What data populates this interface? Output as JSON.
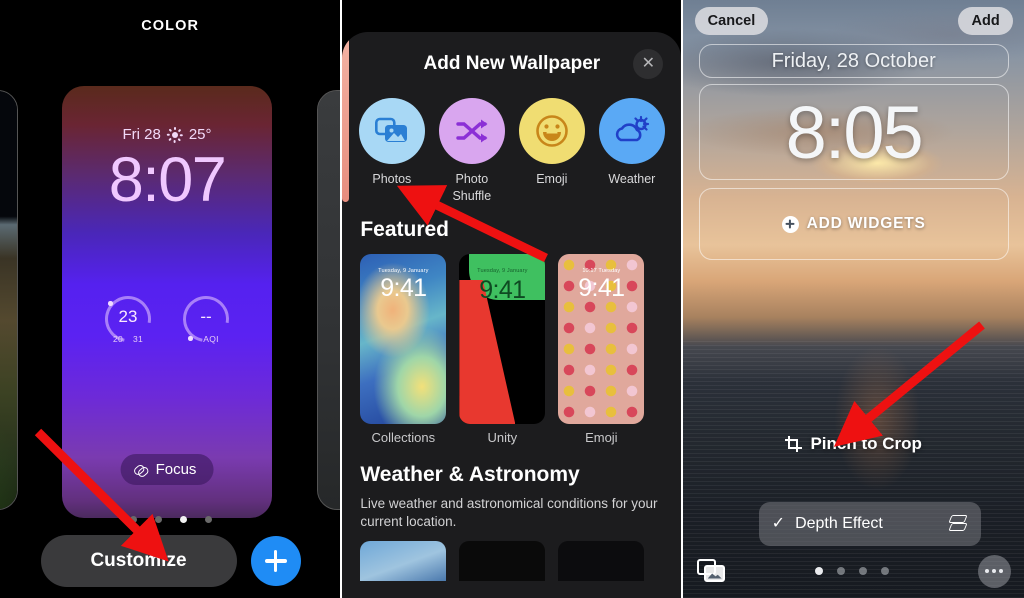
{
  "panel1": {
    "header": "COLOR",
    "preview": {
      "date": "Fri 28",
      "weather_icon": "sun-icon",
      "temperature": "25°",
      "time": "8:07",
      "gauge1": {
        "value": "23",
        "low": "20",
        "high": "31"
      },
      "gauge2": {
        "value": "--",
        "label": "AQI"
      },
      "focus_label": "Focus",
      "focus_icon": "link-icon"
    },
    "page_dots": {
      "count": 4,
      "active": 2
    },
    "customize_label": "Customize",
    "add_icon": "plus-icon"
  },
  "panel2": {
    "sheet_title": "Add New Wallpaper",
    "close_icon": "close-icon",
    "types": [
      {
        "label": "Photos",
        "icon": "photos-icon",
        "circle_color": "#a8d8f5",
        "glyph_color": "#2a7fd4"
      },
      {
        "label": "Photo Shuffle",
        "icon": "shuffle-icon",
        "circle_color": "#d9a6ef",
        "glyph_color": "#8b2fd6"
      },
      {
        "label": "Emoji",
        "icon": "smiley-icon",
        "circle_color": "#f0dd72",
        "glyph_color": "#c8861a"
      },
      {
        "label": "Weather",
        "icon": "weather-icon",
        "circle_color": "#5aa9f5",
        "glyph_color": "#2040c8"
      }
    ],
    "featured": {
      "title": "Featured",
      "items": [
        {
          "caption": "Collections",
          "date": "Tuesday, 9 January",
          "time": "9:41"
        },
        {
          "caption": "Unity",
          "date": "Tuesday, 9 January",
          "time": "9:41"
        },
        {
          "caption": "Emoji",
          "date": "10:17  Tuesday",
          "time": "9:41"
        }
      ]
    },
    "weather_section": {
      "title": "Weather & Astronomy",
      "subtitle": "Live weather and astronomical conditions for your current location."
    }
  },
  "panel3": {
    "cancel_label": "Cancel",
    "add_label": "Add",
    "date": "Friday, 28 October",
    "time": "8:05",
    "add_widgets_label": "ADD WIDGETS",
    "add_widgets_icon": "plus-circle-icon",
    "pinch_label": "Pinch to Crop",
    "pinch_icon": "crop-icon",
    "depth_effect_label": "Depth Effect",
    "depth_checked_icon": "check-icon",
    "depth_layers_icon": "layers-icon",
    "photos_library_icon": "photos-library-icon",
    "more_icon": "ellipsis-icon",
    "page_dots": {
      "count": 4,
      "active": 0
    }
  },
  "annotations": {
    "arrow_color": "#ee1111",
    "arrows": [
      {
        "name": "arrow-to-customize"
      },
      {
        "name": "arrow-to-photos"
      },
      {
        "name": "arrow-to-pinch-to-crop"
      }
    ]
  }
}
